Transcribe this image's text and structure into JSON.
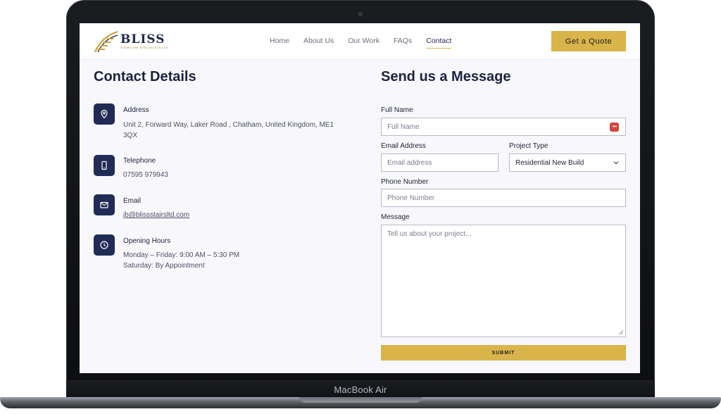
{
  "device": {
    "label": "MacBook Air"
  },
  "header": {
    "logo": {
      "name": "BLISS",
      "tagline": "STAIRCASE SPECIALISTS LTD"
    },
    "nav": [
      {
        "label": "Home",
        "active": false
      },
      {
        "label": "About Us",
        "active": false
      },
      {
        "label": "Our Work",
        "active": false
      },
      {
        "label": "FAQs",
        "active": false
      },
      {
        "label": "Contact",
        "active": true
      }
    ],
    "cta_label": "Get a Quote"
  },
  "contact": {
    "title": "Contact Details",
    "items": [
      {
        "icon": "location-pin-icon",
        "label": "Address",
        "value_line1": "Unit 2, Forward Way, Laker Road , Chatham, United Kingdom, ME1",
        "value_line2": "3QX"
      },
      {
        "icon": "phone-icon",
        "label": "Telephone",
        "value_line1": "07595 979943"
      },
      {
        "icon": "mail-icon",
        "label": "Email",
        "value_line1": "jb@blissstairsltd.com"
      },
      {
        "icon": "clock-icon",
        "label": "Opening Hours",
        "value_line1": "Monday – Friday: 9:00 AM – 5:30 PM",
        "value_line2": "Saturday: By Appointment"
      }
    ]
  },
  "form": {
    "title": "Send us a Message",
    "full_name": {
      "label": "Full Name",
      "placeholder": "Full Name"
    },
    "email": {
      "label": "Email Address",
      "placeholder": "Email address"
    },
    "project_type": {
      "label": "Project Type",
      "value": "Residential New Build"
    },
    "phone": {
      "label": "Phone Number",
      "placeholder": "Phone Number"
    },
    "message": {
      "label": "Message",
      "placeholder": "Tell us about your project..."
    },
    "submit_label": "SUBMIT"
  },
  "colors": {
    "accent_gold": "#d9b44a",
    "navy": "#212b55",
    "page_bg": "#f7f7fc"
  }
}
